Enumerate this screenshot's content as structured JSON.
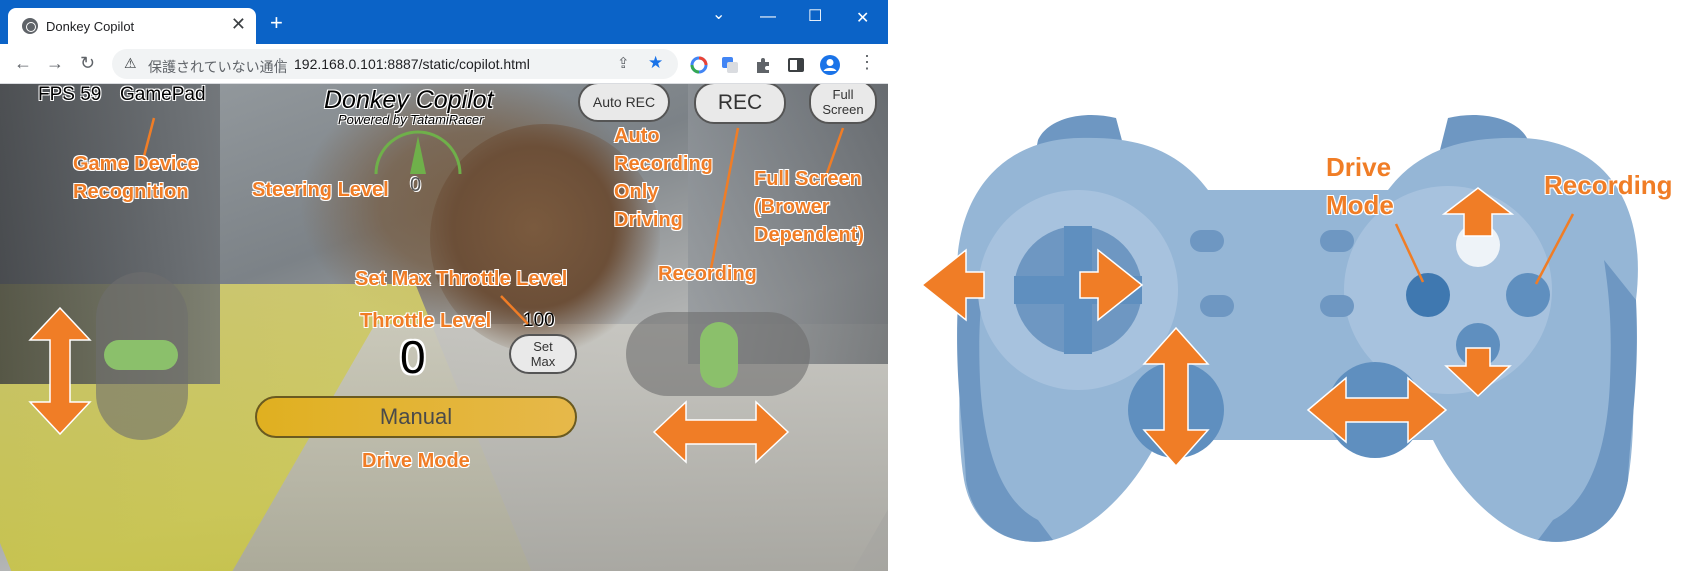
{
  "browser": {
    "tab_title": "Donkey Copilot",
    "new_tab": "+",
    "close_tab": "✕",
    "window_controls": {
      "dropdown": "⌄",
      "minimize": "—",
      "maximize": "☐",
      "close": "✕"
    },
    "security_label": "保護されていない通信",
    "separator": "|",
    "url": "192.168.0.101:8887/static/copilot.html",
    "nav": {
      "back": "←",
      "forward": "→",
      "reload": "↻",
      "menu": "⋮"
    },
    "icons": {
      "favicon": "globe-icon",
      "warning": "warning-icon",
      "share": "share-icon",
      "bookmark": "star-icon"
    }
  },
  "copilot": {
    "fps_label": "FPS 59",
    "device_label": "GamePad",
    "title": "Donkey Copilot",
    "subtitle": "Powered by TatamiRacer",
    "auto_rec_button": "Auto REC",
    "rec_button": "REC",
    "full_screen_button_line1": "Full",
    "full_screen_button_line2": "Screen",
    "steering_value": "0",
    "max_throttle_value": "100",
    "throttle_value": "0",
    "set_max_button_line1": "Set",
    "set_max_button_line2": "Max",
    "drive_mode": "Manual",
    "throttle_slider_level": 0,
    "steering_slider_level": 0
  },
  "annotations": {
    "game_device_line1": "Game Device",
    "game_device_line2": "Recognition",
    "steering_level": "Steering Level",
    "auto_rec_line1": "Auto",
    "auto_rec_line2": "Recording",
    "auto_rec_line3": "Only",
    "auto_rec_line4": "Driving",
    "full_screen_line1": "Full Screen",
    "full_screen_line2": "(Brower",
    "full_screen_line3": "Dependent)",
    "set_max": "Set Max Throttle Level",
    "throttle_level": "Throttle Level",
    "recording": "Recording",
    "drive_mode": "Drive Mode"
  },
  "diagram": {
    "drive_mode_line1": "Drive",
    "drive_mode_line2": "Mode",
    "recording": "Recording"
  },
  "colors": {
    "accent_orange": "#f07d26",
    "slider_green": "#8bc06b",
    "mode_yellow": "#e0b020",
    "controller_light": "#95b6d6",
    "controller_dark": "#5f8fbf",
    "browser_blue": "#0b63c7"
  }
}
